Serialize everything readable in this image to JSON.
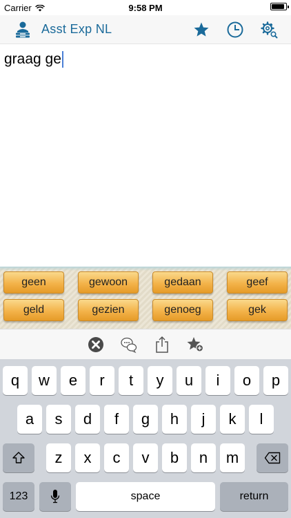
{
  "status_bar": {
    "carrier": "Carrier",
    "time": "9:58 PM",
    "battery_level": 0.9
  },
  "nav": {
    "title": "Asst Exp NL",
    "logo_icon": "person-stack-icon",
    "buttons": [
      {
        "name": "favorites-button",
        "icon": "star-icon"
      },
      {
        "name": "history-button",
        "icon": "clock-icon"
      },
      {
        "name": "settings-button",
        "icon": "gear-search-icon"
      }
    ],
    "accent_color": "#1a6a9a"
  },
  "editor": {
    "text": "graag ge"
  },
  "suggestions": [
    "geen",
    "gewoon",
    "gedaan",
    "geef",
    "geld",
    "gezien",
    "genoeg",
    "gek"
  ],
  "toolbar": {
    "buttons": [
      {
        "name": "clear-button",
        "icon": "x-circle-icon"
      },
      {
        "name": "speech-button",
        "icon": "speech-bubbles-icon"
      },
      {
        "name": "share-button",
        "icon": "share-icon"
      },
      {
        "name": "add-favorite-button",
        "icon": "star-plus-icon"
      }
    ]
  },
  "keyboard": {
    "row1": [
      "q",
      "w",
      "e",
      "r",
      "t",
      "y",
      "u",
      "i",
      "o",
      "p"
    ],
    "row2": [
      "a",
      "s",
      "d",
      "f",
      "g",
      "h",
      "j",
      "k",
      "l"
    ],
    "row3": [
      "z",
      "x",
      "c",
      "v",
      "b",
      "n",
      "m"
    ],
    "numbers_label": "123",
    "space_label": "space",
    "return_label": "return",
    "shift_icon": "shift-icon",
    "delete_icon": "delete-icon",
    "mic_icon": "microphone-icon"
  }
}
